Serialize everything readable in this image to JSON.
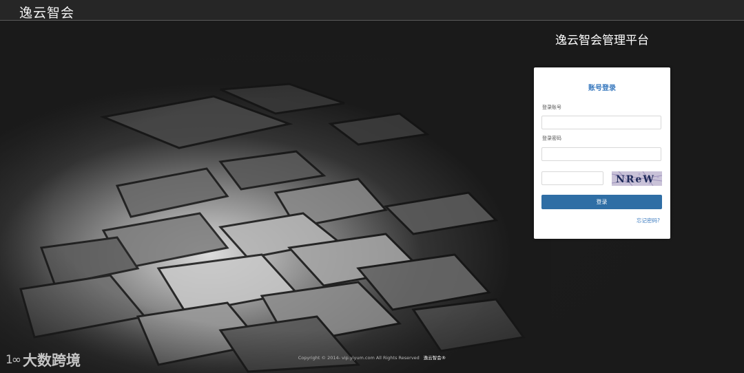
{
  "header": {
    "logo_text": "逸云智会"
  },
  "platform_title": "逸云智会管理平台",
  "login": {
    "title": "账号登录",
    "account_label": "登录账号",
    "account_value": "",
    "password_label": "登录密码",
    "password_value": "",
    "captcha_value": "",
    "captcha_text": "NReW",
    "submit_label": "登录",
    "forgot_label": "忘记密码?"
  },
  "footer": {
    "copyright": "Copyright © 2014- vip.yiyum.com All Rights Reserved",
    "brand": "逸云智会®"
  },
  "watermark": {
    "icon_text": "1∞",
    "text": "大数跨境"
  },
  "colors": {
    "background": "#1a1a1a",
    "accent": "#2f6ea5",
    "title_blue": "#3a7abf"
  }
}
